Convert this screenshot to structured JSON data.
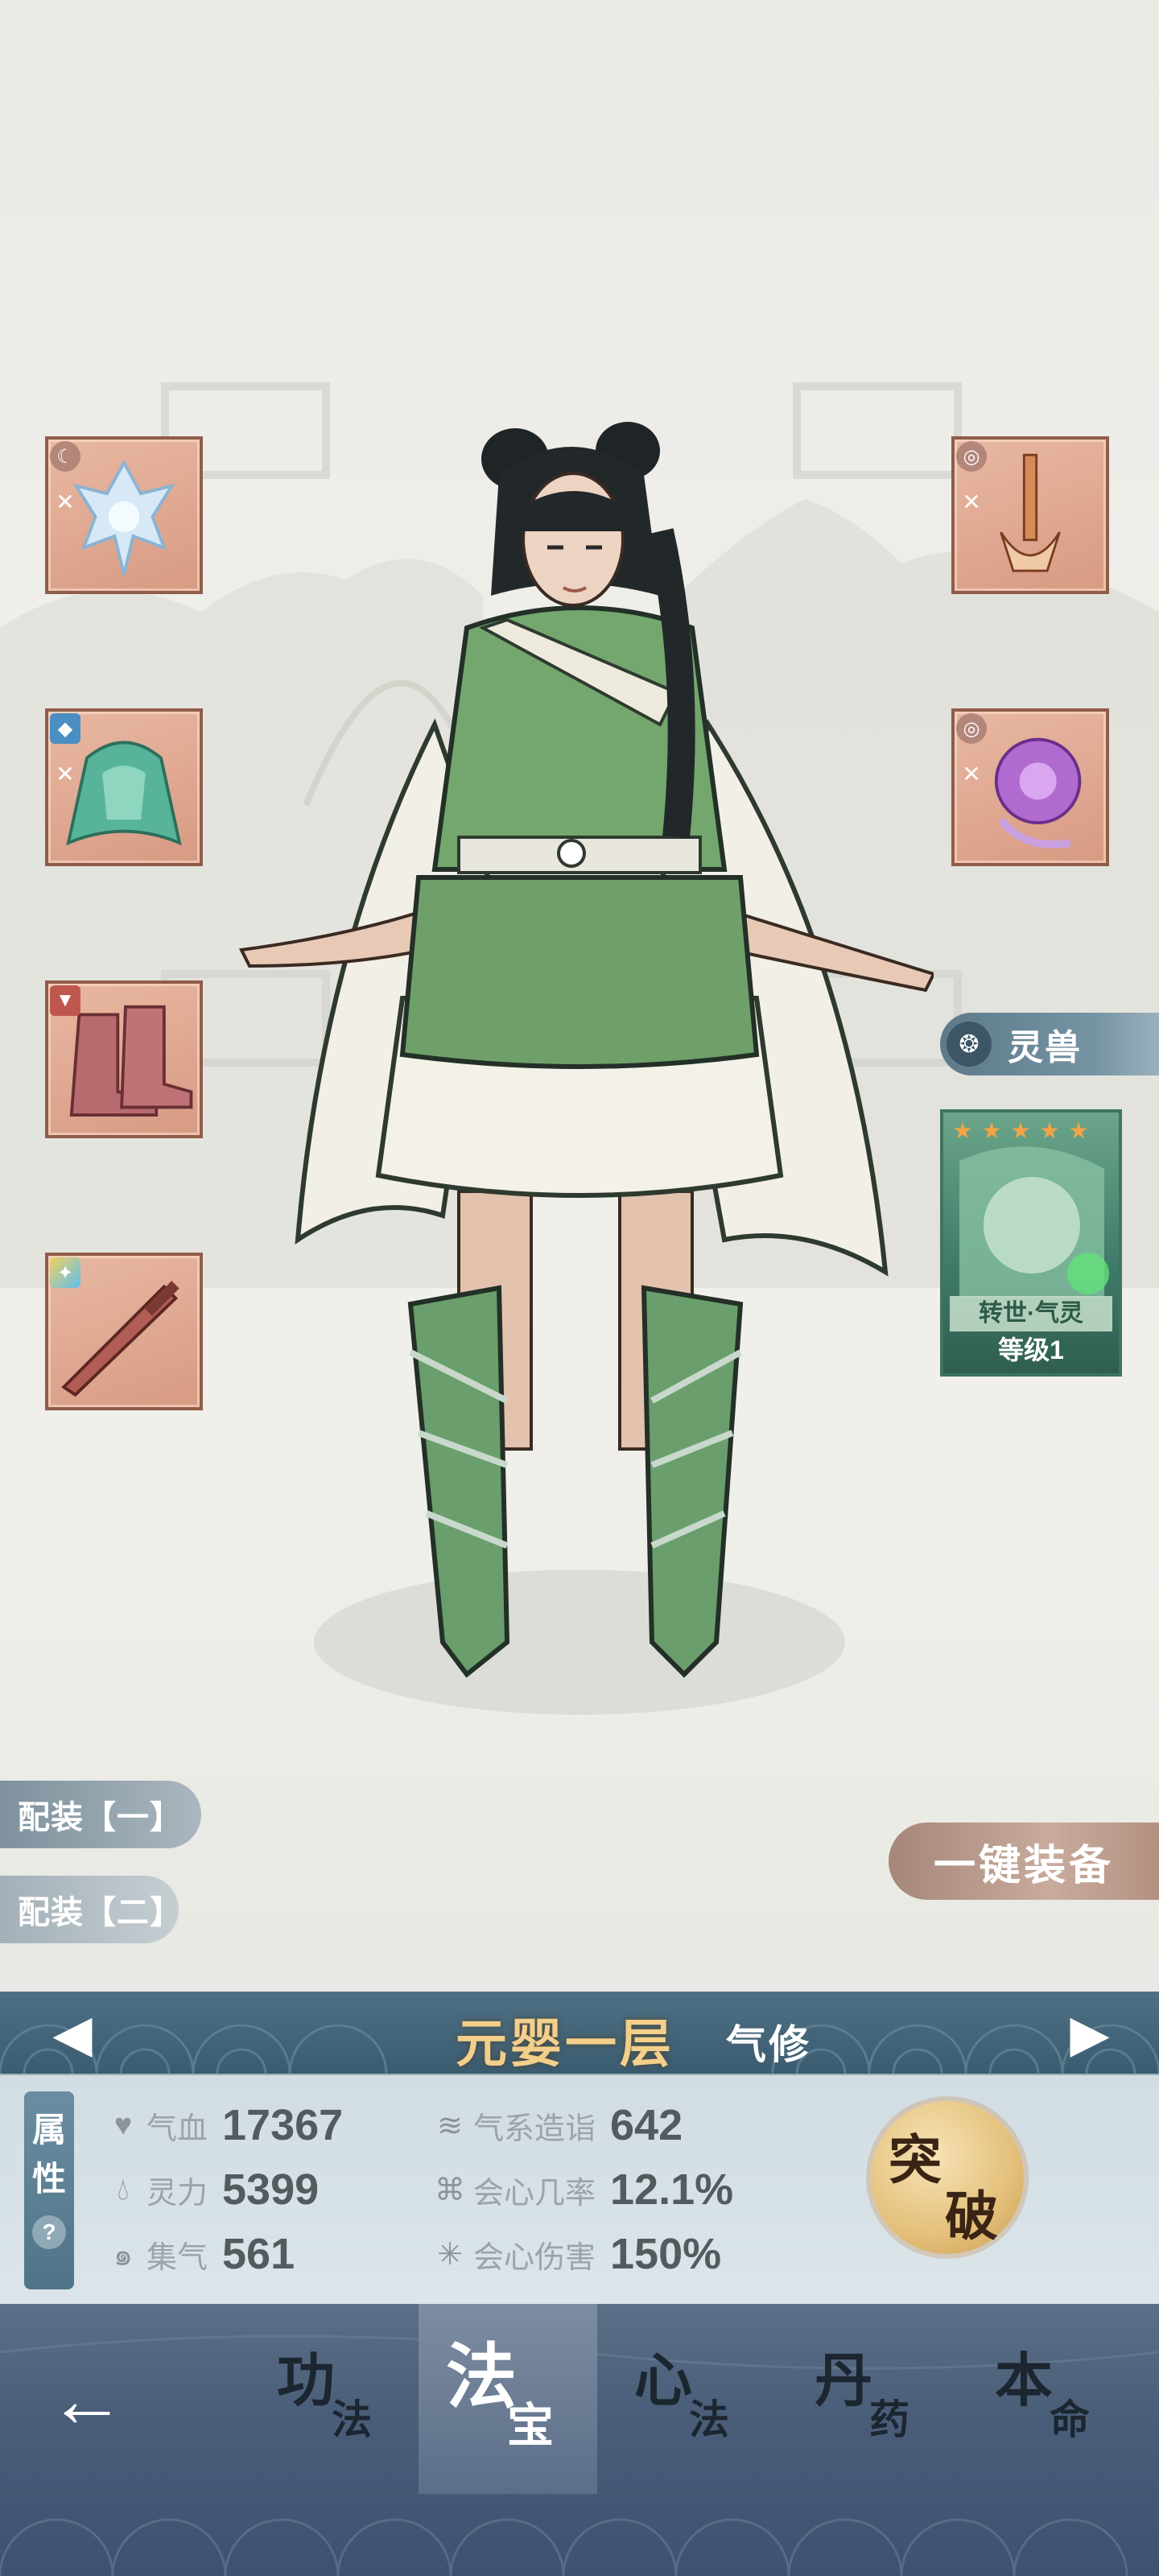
{
  "equipment_slots": {
    "left": [
      {
        "name": "ice-flower-artifact",
        "badge": "moon-icon"
      },
      {
        "name": "green-armor",
        "badge": "armor-icon"
      },
      {
        "name": "boots",
        "badge": "boot-icon"
      },
      {
        "name": "sword",
        "badge": "wing-icon"
      }
    ],
    "right": [
      {
        "name": "ritual-dagger",
        "badge": "ring-icon"
      },
      {
        "name": "purple-orb",
        "badge": "ring-icon"
      }
    ]
  },
  "spirit_beast": {
    "tab_label": "灵兽",
    "card_name": "转世·气灵",
    "card_level": "等级1",
    "stars": 5
  },
  "loadouts": [
    "配装【一】",
    "配装【二】"
  ],
  "equip_all_label": "一键装备",
  "realm": {
    "name": "元婴一层",
    "type": "气修"
  },
  "attributes": {
    "tag": [
      "属",
      "性"
    ],
    "help": "?",
    "stats": [
      {
        "icon": "heart-icon",
        "label": "气血",
        "value": "17367"
      },
      {
        "icon": "drop-icon",
        "label": "灵力",
        "value": "5399"
      },
      {
        "icon": "swirl-icon",
        "label": "集气",
        "value": "561"
      },
      {
        "icon": "wind-icon",
        "label": "气系造诣",
        "value": "642"
      },
      {
        "icon": "crit-rate-icon",
        "label": "会心几率",
        "value": "12.1%"
      },
      {
        "icon": "crit-damage-icon",
        "label": "会心伤害",
        "value": "150%"
      }
    ]
  },
  "breakthrough": [
    "突",
    "破"
  ],
  "nav_tabs": [
    {
      "big": "功",
      "small": "法"
    },
    {
      "big": "法",
      "small": "宝"
    },
    {
      "big": "心",
      "small": "法"
    },
    {
      "big": "丹",
      "small": "药"
    },
    {
      "big": "本",
      "small": "命"
    }
  ],
  "colors": {
    "accent": "#4f7084",
    "gold": "#f3cf8a",
    "slot_border": "#8f5d4a",
    "beast_green": "#3e7a68"
  }
}
